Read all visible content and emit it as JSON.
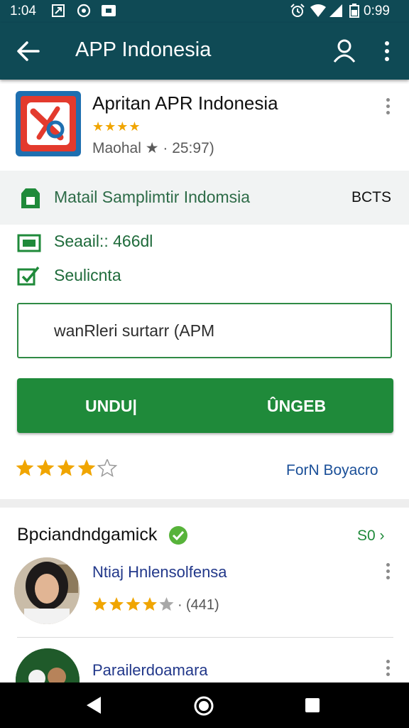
{
  "status_bar": {
    "time": "1:04",
    "battery": "0:99",
    "icons": [
      "notification-icon",
      "cast-icon",
      "photo-icon",
      "alarm-icon",
      "wifi-icon",
      "signal-icon",
      "battery-icon"
    ]
  },
  "app_bar": {
    "title": "APP Indonesia",
    "icons": [
      "back-arrow-icon",
      "account-icon",
      "more-vert-icon"
    ]
  },
  "app": {
    "name": "Apritan APR Indonesia",
    "rating_stars": "★★★★",
    "meta": "Maohal ★ · 25:97)"
  },
  "info_bar": {
    "text": "Matail Samplimtir Indomsia",
    "badge": "BCTS"
  },
  "details": {
    "size_text": "Seaail:: 466dl",
    "security_text": "Seulicnta"
  },
  "input": {
    "value": "wanRleri surtarr (APM"
  },
  "buttons": {
    "primary_label": "UNDU|",
    "secondary_label": "ÛNGEB"
  },
  "rating_row": {
    "stars_value": 4,
    "stars_max": 5,
    "link": "ForN Boyacro"
  },
  "section": {
    "title": "Bpciandndgamick",
    "see_all": "S0 ›"
  },
  "list": [
    {
      "title": "Ntiaj Hnlensolfensa",
      "rating_text": "★★★★★ · (441)",
      "stars_value": 4
    },
    {
      "title": "Parailerdoamara"
    }
  ],
  "colors": {
    "app_bar": "#0f4a55",
    "accent_green": "#1f8a3a",
    "link_blue": "#1a4f98",
    "star": "#f0a500"
  }
}
